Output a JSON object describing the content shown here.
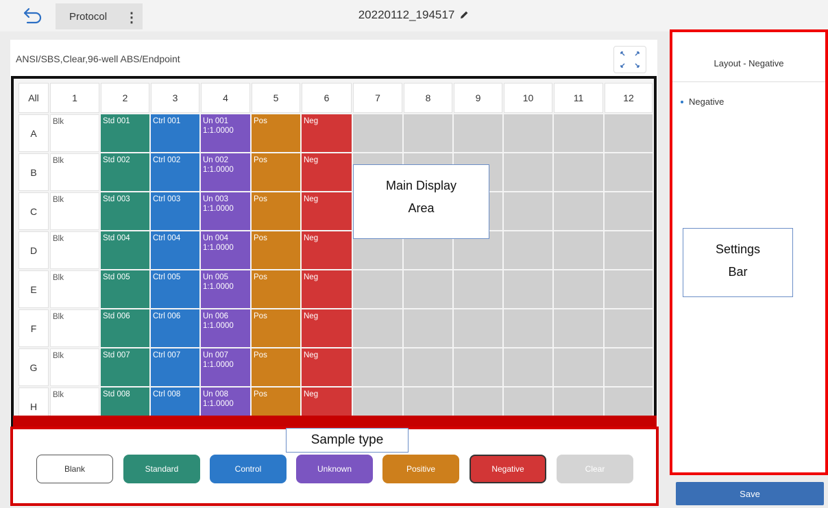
{
  "header": {
    "back_icon": "back-arrow-icon",
    "protocol_label": "Protocol",
    "menu_icon": "more-vertical-icon",
    "experiment_name": "20220112_194517",
    "edit_icon": "pencil-icon"
  },
  "plate": {
    "subtitle": "ANSI/SBS,Clear,96-well  ABS/Endpoint",
    "expand_icon": "expand-icon",
    "all_label": "All",
    "columns": [
      "1",
      "2",
      "3",
      "4",
      "5",
      "6",
      "7",
      "8",
      "9",
      "10",
      "11",
      "12"
    ],
    "rows": [
      "A",
      "B",
      "C",
      "D",
      "E",
      "F",
      "G",
      "H"
    ],
    "wells": [
      [
        "Blk",
        "Std 001",
        "Ctrl 001",
        "Un 001\n1:1.0000",
        "Pos",
        "Neg",
        "",
        "",
        "",
        "",
        "",
        ""
      ],
      [
        "Blk",
        "Std 002",
        "Ctrl 002",
        "Un 002\n1:1.0000",
        "Pos",
        "Neg",
        "",
        "",
        "",
        "",
        "",
        ""
      ],
      [
        "Blk",
        "Std 003",
        "Ctrl 003",
        "Un 003\n1:1.0000",
        "Pos",
        "Neg",
        "",
        "",
        "",
        "",
        "",
        ""
      ],
      [
        "Blk",
        "Std 004",
        "Ctrl 004",
        "Un 004\n1:1.0000",
        "Pos",
        "Neg",
        "",
        "",
        "",
        "",
        "",
        ""
      ],
      [
        "Blk",
        "Std 005",
        "Ctrl 005",
        "Un 005\n1:1.0000",
        "Pos",
        "Neg",
        "",
        "",
        "",
        "",
        "",
        ""
      ],
      [
        "Blk",
        "Std 006",
        "Ctrl 006",
        "Un 006\n1:1.0000",
        "Pos",
        "Neg",
        "",
        "",
        "",
        "",
        "",
        ""
      ],
      [
        "Blk",
        "Std 007",
        "Ctrl 007",
        "Un 007\n1:1.0000",
        "Pos",
        "Neg",
        "",
        "",
        "",
        "",
        "",
        ""
      ],
      [
        "Blk",
        "Std 008",
        "Ctrl 008",
        "Un 008\n1:1.0000",
        "Pos",
        "Neg",
        "",
        "",
        "",
        "",
        "",
        ""
      ]
    ],
    "column_types": [
      "blank",
      "std",
      "ctrl",
      "unk",
      "pos",
      "neg",
      "empty",
      "empty",
      "empty",
      "empty",
      "empty",
      "empty"
    ]
  },
  "annotations": {
    "main_display": [
      "Main Display",
      "Area"
    ],
    "sample_type": "Sample type",
    "settings_bar": [
      "Settings",
      "Bar"
    ]
  },
  "sample_types": [
    {
      "label": "Blank",
      "bg": "#ffffff",
      "fg": "#333333",
      "border": "#555555"
    },
    {
      "label": "Standard",
      "bg": "#2e8c76",
      "fg": "#ffffff",
      "border": "#2e8c76"
    },
    {
      "label": "Control",
      "bg": "#2c79c9",
      "fg": "#ffffff",
      "border": "#2c79c9"
    },
    {
      "label": "Unknown",
      "bg": "#7b55c1",
      "fg": "#ffffff",
      "border": "#7b55c1"
    },
    {
      "label": "Positive",
      "bg": "#cd7f1c",
      "fg": "#ffffff",
      "border": "#cd7f1c"
    },
    {
      "label": "Negative",
      "bg": "#d23636",
      "fg": "#ffffff",
      "border": "#333333"
    },
    {
      "label": "Clear",
      "bg": "#d4d4d4",
      "fg": "#ffffff",
      "border": "#d4d4d4"
    }
  ],
  "settings": {
    "title": "Layout - Negative",
    "items": [
      "Negative"
    ],
    "save_label": "Save"
  }
}
